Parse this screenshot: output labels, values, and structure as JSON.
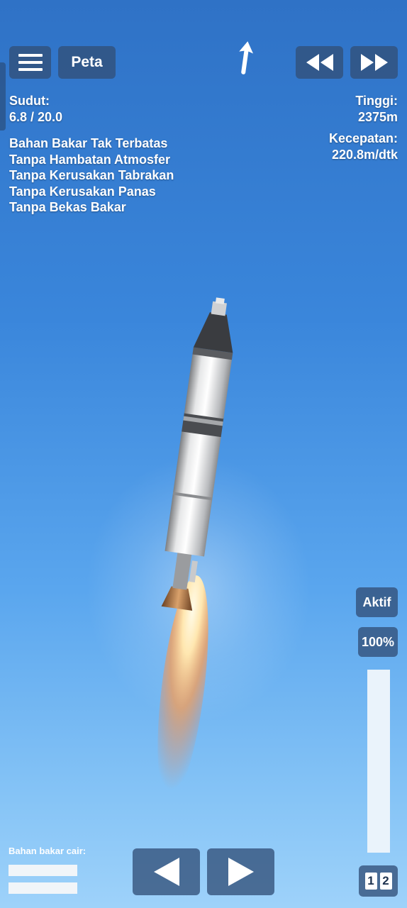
{
  "toolbar": {
    "menu_icon": "hamburger-icon",
    "map_label": "Peta",
    "direction_icon": "prograde-arrow-icon",
    "rewind_icon": "rewind-icon",
    "fast_forward_icon": "fast-forward-icon"
  },
  "hud": {
    "angle_label": "Sudut:",
    "angle_value": "6.8 / 20.0",
    "altitude_label": "Tinggi:",
    "altitude_value": "2375m",
    "velocity_label": "Kecepatan:",
    "velocity_value": "220.8m/dtk",
    "cheats": [
      "Bahan Bakar Tak Terbatas",
      "Tanpa Hambatan Atmosfer",
      "Tanpa Kerusakan Tabrakan",
      "Tanpa Kerusakan Panas",
      "Tanpa Bekas Bakar"
    ]
  },
  "controls": {
    "engine_state_label": "Aktif",
    "throttle_label": "100%",
    "throttle_fraction": 1.0,
    "rotate_left_icon": "triangle-left-icon",
    "rotate_right_icon": "triangle-right-icon",
    "stage_numbers": [
      "1",
      "2"
    ]
  },
  "fuel": {
    "label": "Bahan bakar cair:",
    "levels": [
      1.0,
      1.0
    ]
  },
  "colors": {
    "sky_top": "#2f72c6",
    "sky_bottom": "#9ed2fa",
    "button_bg": "#325078",
    "flame_core": "#fff6d8",
    "flame_outer": "#ff9a4a"
  }
}
